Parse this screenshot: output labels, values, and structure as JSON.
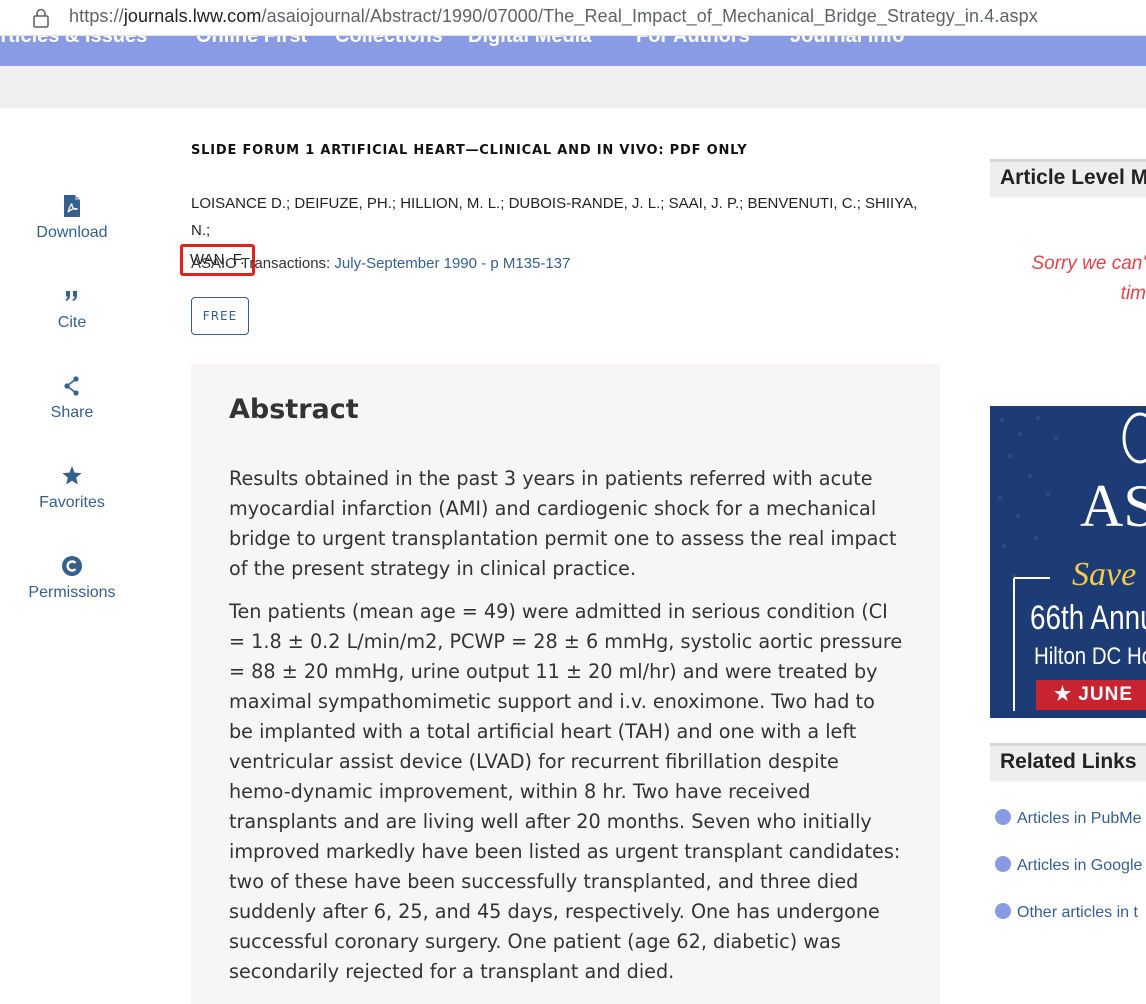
{
  "browser": {
    "url_prefix": "https://",
    "url_host": "journals.lww.com",
    "url_path": "/asaiojournal/Abstract/1990/07000/The_Real_Impact_of_Mechanical_Bridge_Strategy_in.4.aspx"
  },
  "nav": {
    "items": [
      "Articles & Issues",
      "Online First",
      "Collections",
      "Digital Media",
      "For Authors",
      "Journal Info"
    ]
  },
  "toolbar": {
    "download_label": "Download",
    "cite_label": "Cite",
    "share_label": "Share",
    "favorites_label": "Favorites",
    "permissions_label": "Permissions"
  },
  "article": {
    "section": "SLIDE FORUM 1 ARTIFICIAL HEART—CLINICAL AND IN VIVO: PDF ONLY",
    "authors_line1": "LOISANCE D.; DEIFUZE, PH.; HILLION, M. L.; DUBOIS-RANDE, J. L.; SAAI, J. P.; BENVENUTI, C.; SHIIYA, N.;",
    "authors_highlighted": "WAN, F.",
    "journal": "ASAIO Transactions:",
    "issue_link": "July-September 1990 - p M135-137",
    "badge": "FREE"
  },
  "abstract": {
    "heading": "Abstract",
    "p1": "Results obtained in the past 3 years in patients referred with acute myocardial infarction (AMI) and cardiogenic shock for a mechanical bridge to urgent transplantation permit one to assess the real impact of the present strategy in clinical practice.",
    "p2": "Ten patients (mean age = 49) were admitted in serious condition (CI = 1.8 ± 0.2 L/min/m2, PCWP = 28 ± 6 mmHg, systolic aortic pressure = 88 ± 20 mmHg, urine output 11 ± 20 ml/hr) and were treated by maximal sympathomimetic support and i.v. enoximone. Two had to be implanted with a total artificial heart (TAH) and one with a left ventricular assist device (LVAD) for recurrent fibrillation despite hemo-dynamic improvement, within 8 hr. Two have received transplants and are living well after 20 months. Seven who initially improved markedly have been listed as urgent transplant candidates: two of these have been successfully transplanted, and three died suddenly after 6, 25, and 45 days, respectively. One has undergone successful coronary surgery. One patient (age 62, diabetic) was secondarily rejected for a transplant and died."
  },
  "sidebar": {
    "metrics_heading": "Article Level M",
    "sorry_line1": "Sorry we can'",
    "sorry_line2": "tim",
    "ad": {
      "brand": "AS",
      "save": "Save",
      "annual": "66th Annu",
      "venue": "Hilton DC Hot",
      "date": "★ JUNE"
    },
    "related_heading": "Related Links",
    "related_links": [
      "Articles in PubMe",
      "Articles in Google",
      "Other articles in t"
    ]
  },
  "colors": {
    "link": "#355f8d",
    "nav_bar": "#8a9be6",
    "highlight_box": "#e0231c",
    "error_text": "#e0434b",
    "ad_background": "#1d3c75"
  }
}
